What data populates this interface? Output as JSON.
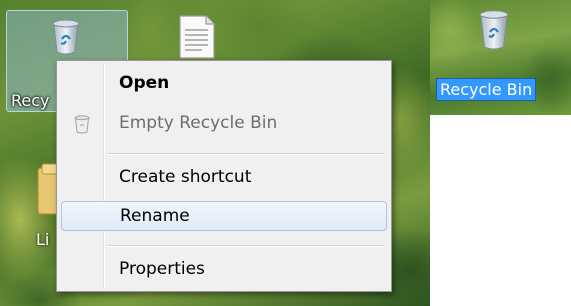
{
  "desktop": {
    "icons": [
      {
        "label": "Recycle Bin",
        "selected": true,
        "renamed_preview": "Recy"
      },
      {
        "label": "Li"
      }
    ]
  },
  "rename_preview": {
    "label": "Recycle Bin"
  },
  "context_menu": {
    "items": [
      {
        "label": "Open",
        "bold": true
      },
      {
        "label": "Empty Recycle Bin",
        "disabled": true,
        "icon": "recycle-bin-icon"
      },
      {
        "label": "Create shortcut"
      },
      {
        "label": "Rename",
        "highlighted": true
      },
      {
        "label": "Properties"
      }
    ]
  },
  "colors": {
    "menu_background": "#f0f0f0",
    "highlight_border": "#a8c4e6",
    "selection_blue": "#3399ff",
    "disabled_text": "#6d6d6d"
  }
}
